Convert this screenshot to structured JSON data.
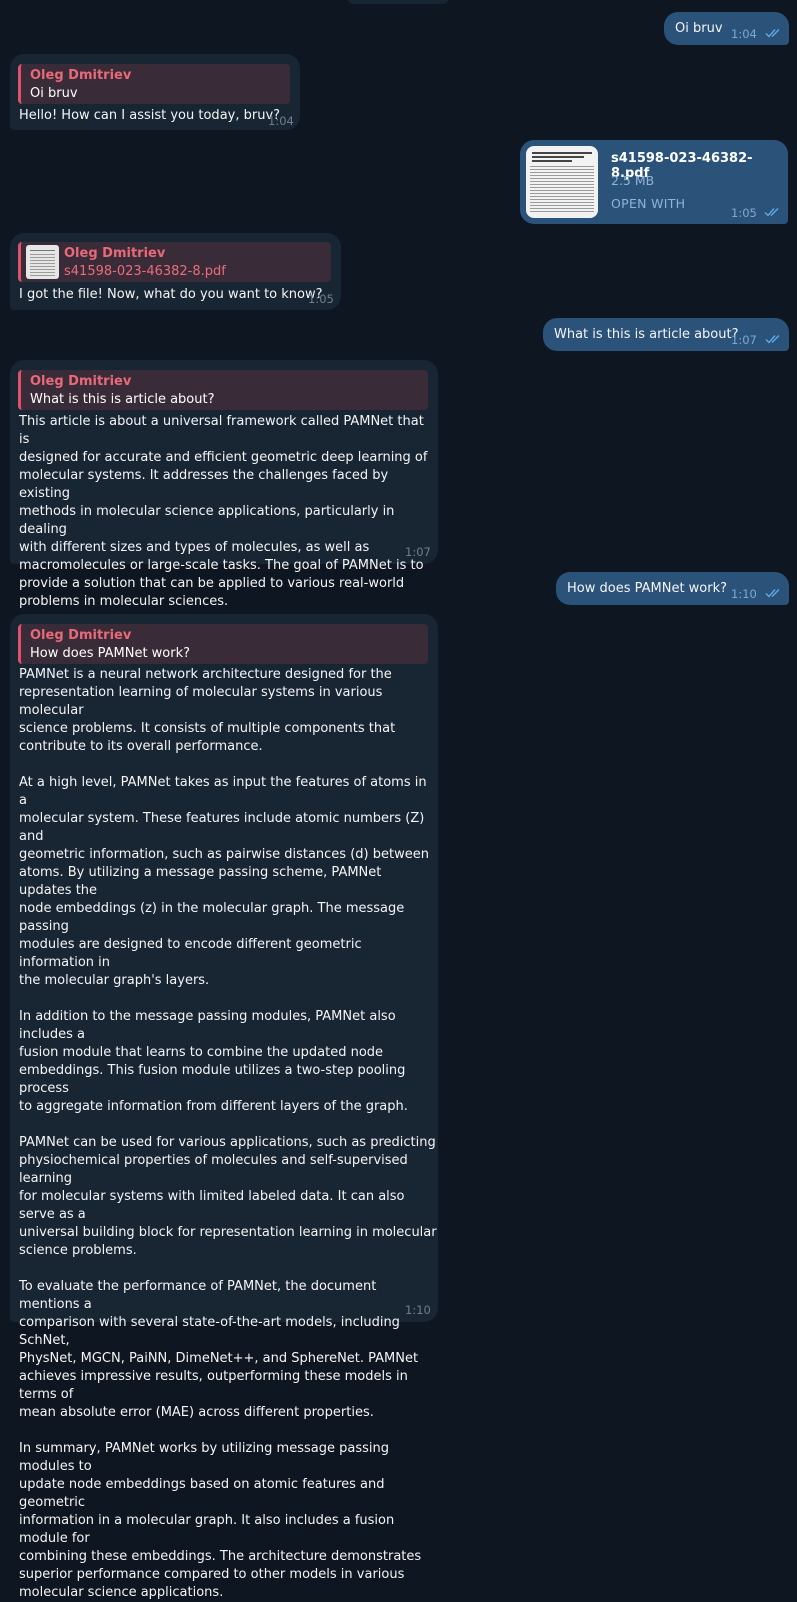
{
  "chat": {
    "contact_name": "Oleg Dmitriev",
    "messages": [
      {
        "text": "Oi bruv",
        "time": "1:04"
      },
      {
        "reply_name": "Oleg Dmitriev",
        "reply_text": "Oi bruv",
        "text": "Hello! How can I assist you today, bruv?",
        "time": "1:04"
      },
      {
        "file_name": "s41598-023-46382-8.pdf",
        "file_size": "2.5 MB",
        "action": "OPEN WITH",
        "time": "1:05",
        "thumb_title": "A universal framework for accurate and efficient geometric deep learning of molecular systems"
      },
      {
        "reply_name": "Oleg Dmitriev",
        "reply_text": "s41598-023-46382-8.pdf",
        "text": "I got the file! Now, what do you want to know?",
        "time": "1:05"
      },
      {
        "text": "What is this is article about?",
        "time": "1:07"
      },
      {
        "reply_name": "Oleg Dmitriev",
        "reply_text": "What is this is article about?",
        "text": "This article is about a universal framework called PAMNet that is\ndesigned for accurate and efficient geometric deep learning of\nmolecular systems. It addresses the challenges faced by existing\nmethods in molecular science applications, particularly in dealing\nwith different sizes and types of molecules, as well as\nmacromolecules or large-scale tasks. The goal of PAMNet is to\nprovide a solution that can be applied to various real-world\nproblems in molecular sciences.",
        "time": "1:07"
      },
      {
        "text": "How does PAMNet work?",
        "time": "1:10"
      },
      {
        "reply_name": "Oleg Dmitriev",
        "reply_text": "How does PAMNet work?",
        "text": "PAMNet is a neural network architecture designed for the\nrepresentation learning of molecular systems in various molecular\nscience problems. It consists of multiple components that\ncontribute to its overall performance.\n\nAt a high level, PAMNet takes as input the features of atoms in a\nmolecular system. These features include atomic numbers (Z) and\ngeometric information, such as pairwise distances (d) between\natoms. By utilizing a message passing scheme, PAMNet updates the\nnode embeddings (z) in the molecular graph. The message passing\nmodules are designed to encode different geometric information in\nthe molecular graph's layers.\n\nIn addition to the message passing modules, PAMNet also includes a\nfusion module that learns to combine the updated node\nembeddings. This fusion module utilizes a two-step pooling process\nto aggregate information from different layers of the graph.\n\nPAMNet can be used for various applications, such as predicting\nphysiochemical properties of molecules and self-supervised learning\nfor molecular systems with limited labeled data. It can also serve as a\nuniversal building block for representation learning in molecular\nscience problems.\n\nTo evaluate the performance of PAMNet, the document mentions a\ncomparison with several state-of-the-art models, including SchNet,\nPhysNet, MGCN, PaiNN, DimeNet++, and SphereNet. PAMNet\nachieves impressive results, outperforming these models in terms of\nmean absolute error (MAE) across different properties.\n\nIn summary, PAMNet works by utilizing message passing modules to\nupdate node embeddings based on atomic features and geometric\ninformation in a molecular graph. It also includes a fusion module for\ncombining these embeddings. The architecture demonstrates\nsuperior performance compared to other models in various\nmolecular science applications.",
        "time": "1:10"
      }
    ]
  },
  "colors": {
    "background": "#0e1621",
    "outgoing_bubble": "#2b5278",
    "incoming_bubble": "#182533",
    "reply_accent": "#e0506a",
    "read_ticks": "#5fa8e8"
  }
}
